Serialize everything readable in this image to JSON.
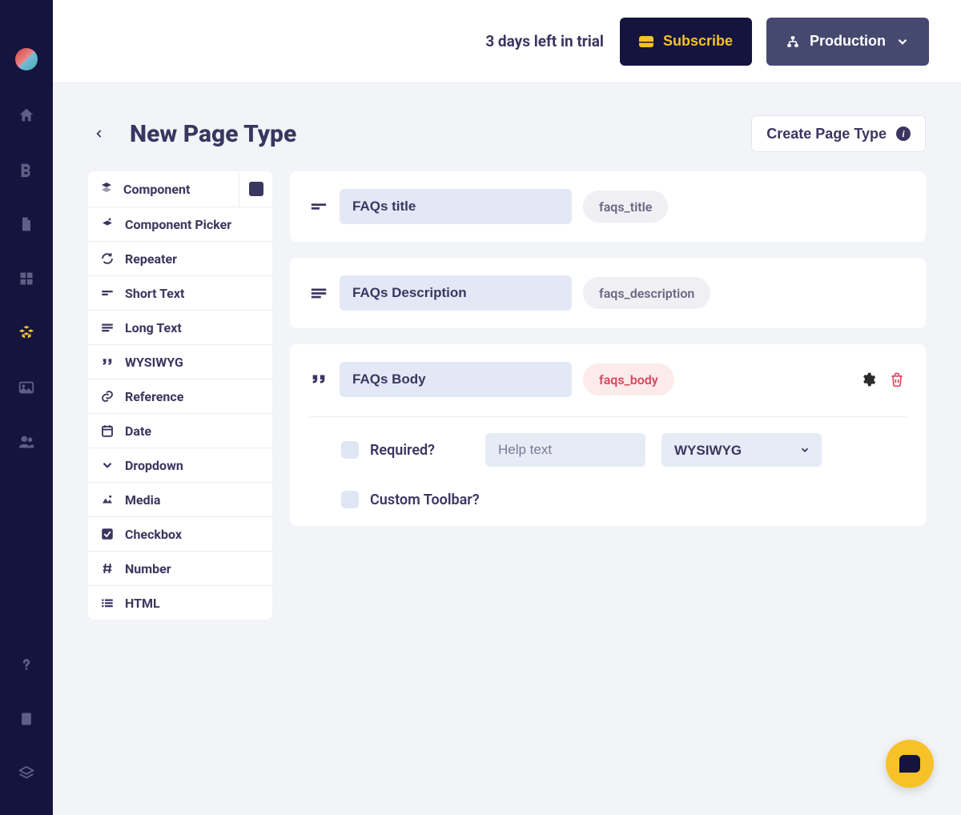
{
  "topbar": {
    "trial": "3 days left in trial",
    "subscribe": "Subscribe",
    "env": "Production"
  },
  "page": {
    "title": "New Page Type",
    "create": "Create Page Type"
  },
  "palette": {
    "component": "Component",
    "component_picker": "Component Picker",
    "repeater": "Repeater",
    "short_text": "Short Text",
    "long_text": "Long Text",
    "wysiwyg": "WYSIWYG",
    "reference": "Reference",
    "date": "Date",
    "dropdown": "Dropdown",
    "media": "Media",
    "checkbox": "Checkbox",
    "number": "Number",
    "html": "HTML"
  },
  "fields": {
    "f0": {
      "label": "FAQs title",
      "slug": "faqs_title"
    },
    "f1": {
      "label": "FAQs Description",
      "slug": "faqs_description"
    },
    "f2": {
      "label": "FAQs Body",
      "slug": "faqs_body",
      "required_label": "Required?",
      "help_placeholder": "Help text",
      "type_selected": "WYSIWYG",
      "custom_toolbar_label": "Custom Toolbar?"
    }
  }
}
